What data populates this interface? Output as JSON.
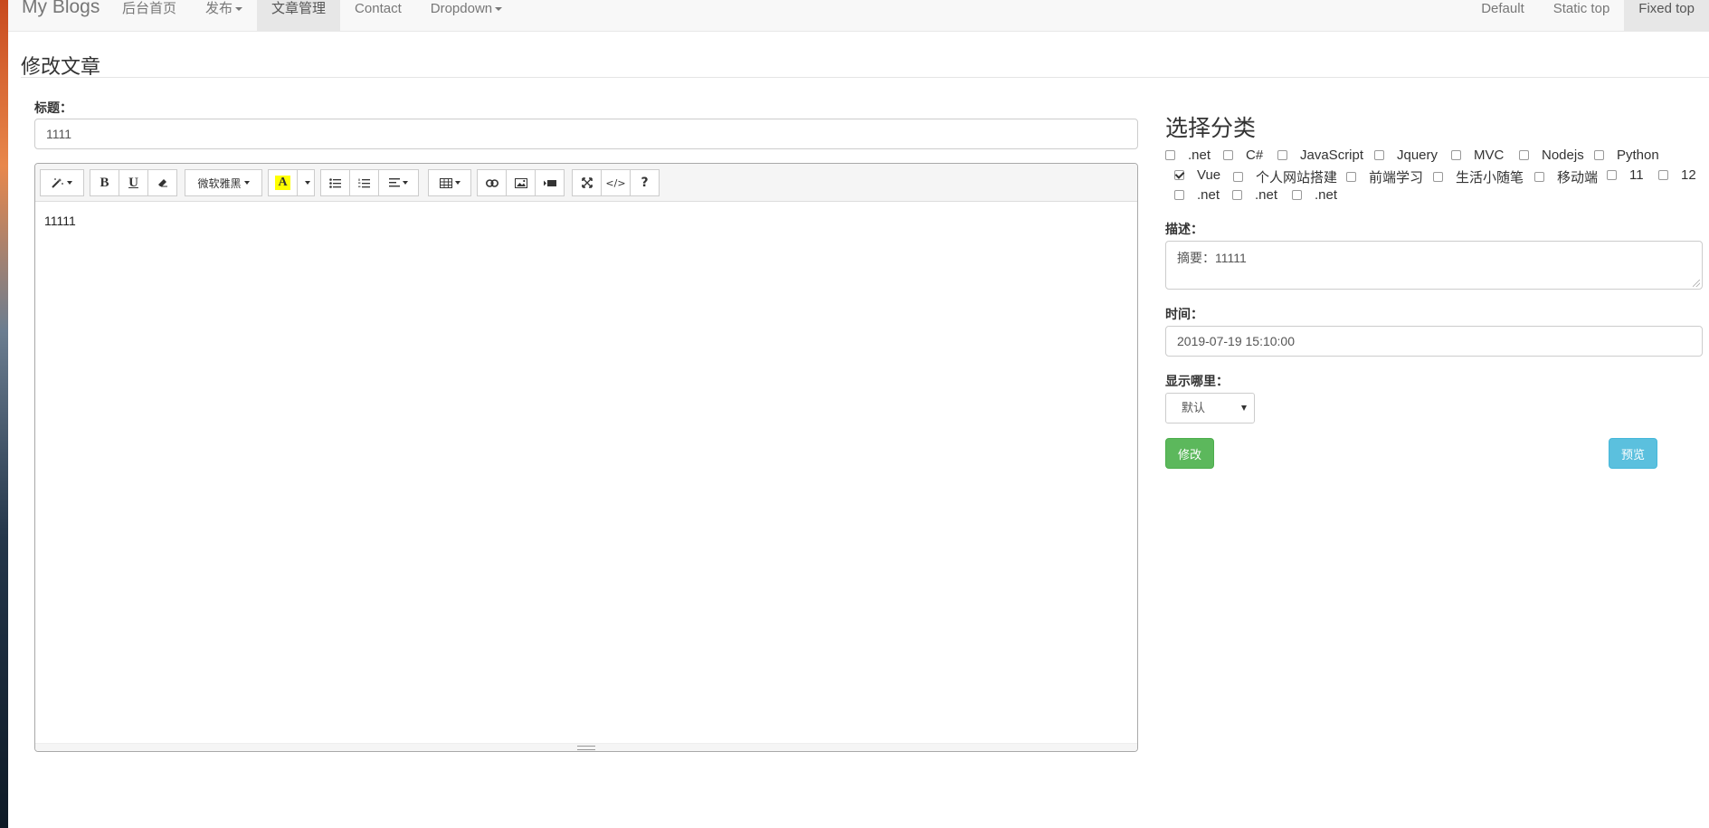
{
  "navbar": {
    "brand": "My Blogs",
    "left_items": [
      {
        "label": "后台首页",
        "dropdown": false,
        "active": false
      },
      {
        "label": "发布",
        "dropdown": true,
        "active": false
      },
      {
        "label": "文章管理",
        "dropdown": false,
        "active": true
      },
      {
        "label": "Contact",
        "dropdown": false,
        "active": false
      },
      {
        "label": "Dropdown",
        "dropdown": true,
        "active": false
      }
    ],
    "right_items": [
      {
        "label": "Default",
        "active": false
      },
      {
        "label": "Static top",
        "active": false
      },
      {
        "label": "Fixed top",
        "active": true
      }
    ]
  },
  "page": {
    "title": "修改文章"
  },
  "form": {
    "title_label": "标题：",
    "title_value": "1111",
    "editor": {
      "font_select": "微软雅黑",
      "color_button_label": "A",
      "bold_label": "B",
      "underline_label": "U",
      "help_label": "?",
      "code_label": "</>",
      "content": "11111"
    }
  },
  "sidebar": {
    "category_title": "选择分类",
    "categories": [
      {
        "label": ".net",
        "checked": false
      },
      {
        "label": "C#",
        "checked": false
      },
      {
        "label": "JavaScript",
        "checked": false
      },
      {
        "label": "Jquery",
        "checked": false
      },
      {
        "label": "MVC",
        "checked": false
      },
      {
        "label": "Nodejs",
        "checked": false
      },
      {
        "label": "Python",
        "checked": false
      },
      {
        "label": "Vue",
        "checked": true
      },
      {
        "label": "个人网站搭建",
        "checked": false
      },
      {
        "label": "前端学习",
        "checked": false
      },
      {
        "label": "生活小随笔",
        "checked": false
      },
      {
        "label": "移动端",
        "checked": false
      },
      {
        "label": "11",
        "checked": false
      },
      {
        "label": "12",
        "checked": false
      },
      {
        "label": ".net",
        "checked": false
      },
      {
        "label": ".net",
        "checked": false
      },
      {
        "label": ".net",
        "checked": false
      }
    ],
    "description_label": "描述：",
    "description_value": "摘要：11111",
    "time_label": "时间：",
    "time_value": "2019-07-19 15:10:00",
    "display_label": "显示哪里：",
    "display_selected": "默认",
    "save_button": "修改",
    "preview_button": "预览"
  },
  "colors": {
    "success": "#5cb85c",
    "info": "#5bc0de",
    "navbar_bg": "#f8f8f8",
    "highlight_yellow": "#ffff00"
  }
}
